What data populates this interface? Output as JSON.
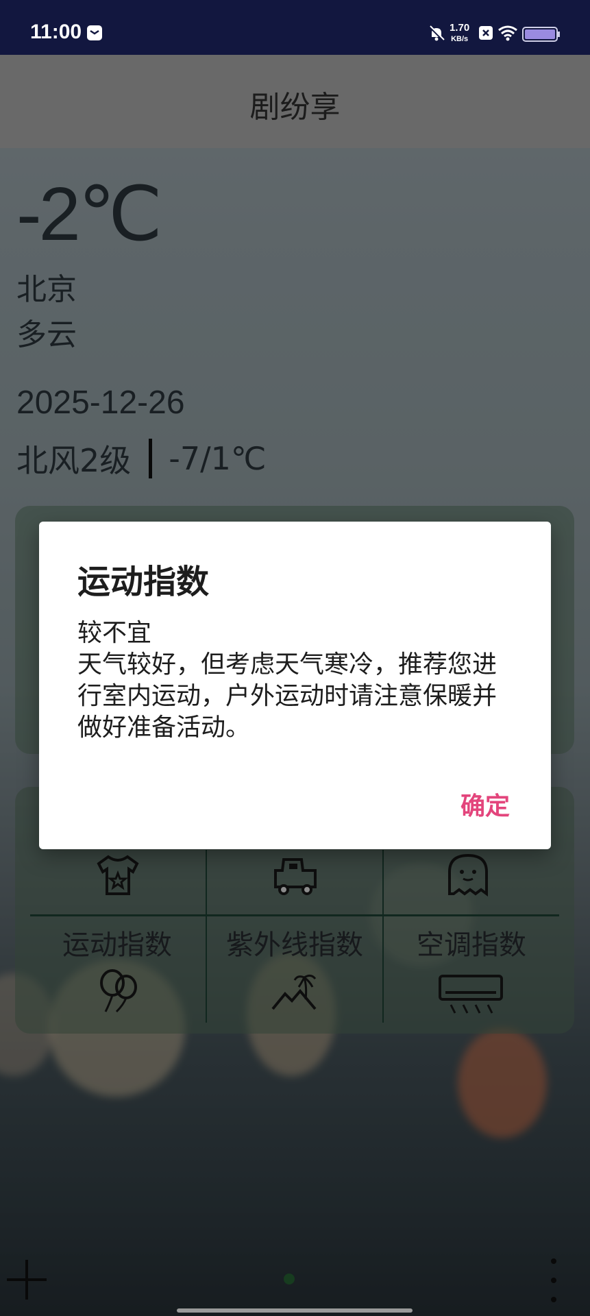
{
  "status_bar": {
    "time": "11:00",
    "net_speed_value": "1.70",
    "net_speed_unit": "KB/s"
  },
  "app_bar": {
    "title": "剧纷享"
  },
  "weather": {
    "temperature": "-2℃",
    "city": "北京",
    "condition": "多云",
    "date": "2025-12-26",
    "wind": "北风2级",
    "range": "-7/1℃"
  },
  "index_grid": {
    "labels": [
      "运动指数",
      "紫外线指数",
      "空调指数"
    ],
    "icons": [
      "tshirt-icon",
      "car-icon",
      "ghost-icon",
      "balloons-icon",
      "beach-icon",
      "air-conditioner-icon"
    ]
  },
  "dialog": {
    "title": "运动指数",
    "level": "较不宜",
    "description": "天气较好，但考虑天气寒冷，推荐您进行室内运动，户外运动时请注意保暖并做好准备活动。",
    "ok_label": "确定"
  },
  "colors": {
    "status_bar_bg": "#12173f",
    "dialog_button": "#e3457c",
    "grid_line": "#20483a"
  }
}
